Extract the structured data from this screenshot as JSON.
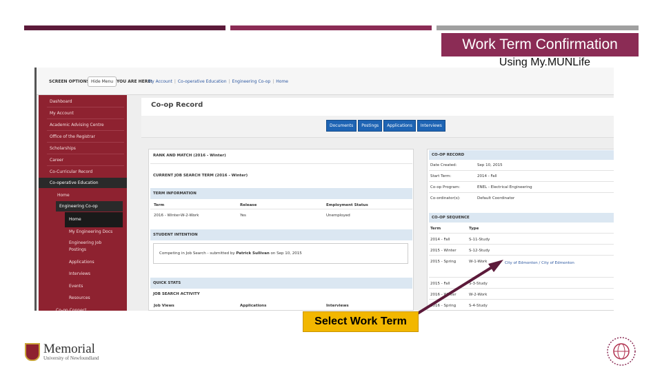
{
  "slide": {
    "title": "Work Term Confirmation",
    "subtitle": "Using My.MUNLife",
    "callout": "Select Work Term",
    "colors": {
      "accent": "#8b2c55",
      "dark": "#5c1a3a",
      "gray": "#a0a0a0",
      "callout": "#f2b700"
    }
  },
  "logo": {
    "name": "Memorial",
    "sub": "University of Newfoundland"
  },
  "screen": {
    "screen_options": "SCREEN OPTIONS:",
    "hide_menu": "Hide Menu",
    "you_are_here": "YOU ARE HERE:",
    "crumbs": [
      "My Account",
      "Co-operative Education",
      "Engineering Co-op",
      "Home"
    ]
  },
  "sidebar": {
    "items": [
      "Dashboard",
      "My Account",
      "Academic Advising Centre",
      "Office of the Registrar",
      "Scholarships",
      "Career",
      "Co-Curricular Record",
      "Co-operative Education"
    ],
    "sub": [
      "Home",
      "Engineering Co-op"
    ],
    "sub2": [
      "Home",
      "My Engineering Docs",
      "Engineering Job Postings",
      "Applications",
      "Interviews",
      "Events",
      "Resources"
    ],
    "more": "Co-op Connect"
  },
  "main": {
    "title": "Co-op Record",
    "buttons": [
      "Documents",
      "Postings",
      "Applications",
      "Interviews"
    ]
  },
  "left": {
    "rank": "RANK AND MATCH (2016 - Winter)",
    "current": "CURRENT JOB SEARCH TERM (2016 - Winter)",
    "term_info": "TERM INFORMATION",
    "cols": [
      "Term",
      "Release",
      "Employment Status"
    ],
    "row": [
      "2016 - Winter-W-2-Work",
      "Yes",
      "Unemployed"
    ],
    "student_intention": "STUDENT INTENTION",
    "intent_prefix": "Competing in Job Search - submitted by",
    "intent_name": "Patrick Sullivan",
    "intent_suffix": "on Sep 10, 2015",
    "quick_stats": "QUICK STATS",
    "activity": "JOB SEARCH ACTIVITY",
    "stat_cols": [
      "Job Views",
      "Applications",
      "Interviews"
    ]
  },
  "right": {
    "record": "CO-OP RECORD",
    "fields": [
      {
        "k": "Date Created:",
        "v": "Sep 10, 2015"
      },
      {
        "k": "Start Term:",
        "v": "2014 - Fall"
      },
      {
        "k": "Co-op Program:",
        "v": "ENEL - Electrical Engineering"
      },
      {
        "k": "Co-ordinator(s):",
        "v": "Default Coordinator"
      }
    ],
    "sequence": "CO-OP SEQUENCE",
    "seq_cols": [
      "Term",
      "Type"
    ],
    "seq": [
      {
        "t": "2014 - Fall",
        "y": "S-11-Study",
        "e": ""
      },
      {
        "t": "2015 - Winter",
        "y": "S-12-Study",
        "e": ""
      },
      {
        "t": "2015 - Spring",
        "y": "W-1-Work",
        "e": "City of Edmonton / City of Edmonton"
      },
      {
        "t": "2015 - Fall",
        "y": "S-3-Study",
        "e": ""
      },
      {
        "t": "2016 - Winter",
        "y": "W-2-Work",
        "e": ""
      },
      {
        "t": "2016 - Spring",
        "y": "S-4-Study",
        "e": ""
      }
    ]
  }
}
